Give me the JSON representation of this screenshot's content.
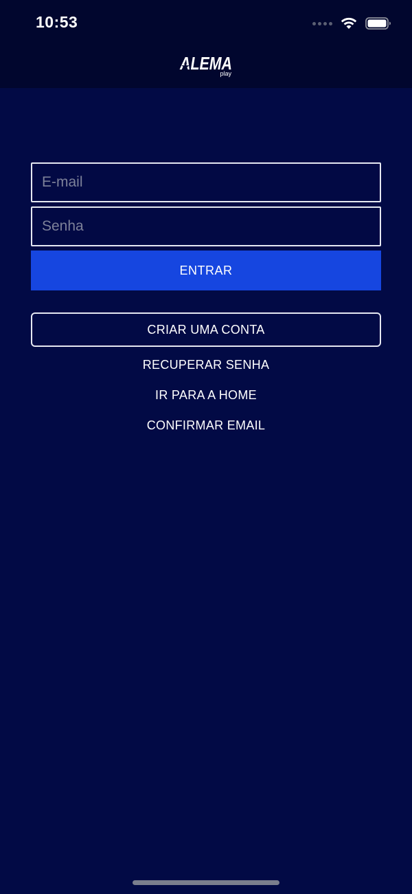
{
  "status_bar": {
    "time": "10:53",
    "icons": [
      "signal-dots-icon",
      "wifi-icon",
      "battery-icon"
    ]
  },
  "header": {
    "logo_text": "ALEMA",
    "logo_subtext": "play"
  },
  "login_form": {
    "email_placeholder": "E-mail",
    "password_placeholder": "Senha",
    "submit_label": "ENTRAR"
  },
  "actions": {
    "create_account_label": "CRIAR UMA CONTA",
    "recover_password_label": "RECUPERAR SENHA",
    "go_home_label": "IR PARA A HOME",
    "confirm_email_label": "CONFIRMAR EMAIL"
  },
  "colors": {
    "background": "#020a45",
    "header_background": "#01062e",
    "primary_button": "#1646e0",
    "border": "#e6e8f2",
    "text": "#ffffff"
  }
}
